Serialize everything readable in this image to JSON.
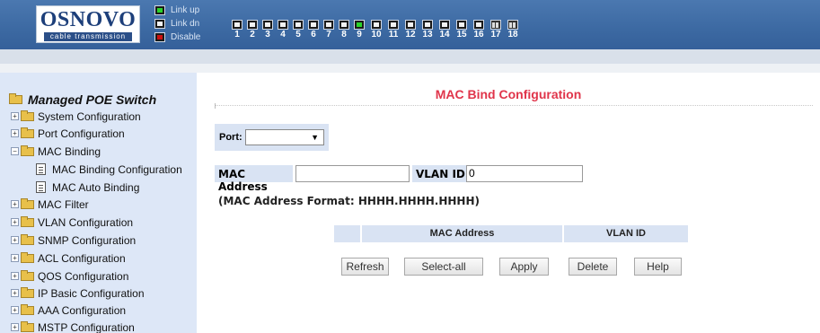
{
  "header": {
    "logo_main": "OSNOVO",
    "logo_sub": "cable transmission",
    "legend": [
      {
        "state": "up",
        "label": "Link up"
      },
      {
        "state": "dn",
        "label": "Link dn"
      },
      {
        "state": "down",
        "label": "Disable"
      }
    ],
    "ports": [
      {
        "num": "1",
        "state": "dn"
      },
      {
        "num": "2",
        "state": "dn"
      },
      {
        "num": "3",
        "state": "dn"
      },
      {
        "num": "4",
        "state": "dn"
      },
      {
        "num": "5",
        "state": "dn"
      },
      {
        "num": "6",
        "state": "dn"
      },
      {
        "num": "7",
        "state": "dn"
      },
      {
        "num": "8",
        "state": "dn"
      },
      {
        "num": "9",
        "state": "up"
      },
      {
        "num": "10",
        "state": "dn"
      },
      {
        "num": "11",
        "state": "dn"
      },
      {
        "num": "12",
        "state": "dn"
      },
      {
        "num": "13",
        "state": "dn"
      },
      {
        "num": "14",
        "state": "dn"
      },
      {
        "num": "15",
        "state": "dn"
      },
      {
        "num": "16",
        "state": "dn"
      },
      {
        "num": "17",
        "state": "fiber"
      },
      {
        "num": "18",
        "state": "fiber"
      }
    ]
  },
  "sidebar": {
    "title": "Managed POE Switch",
    "items": [
      {
        "label": "System Configuration",
        "type": "folder",
        "expander": "+"
      },
      {
        "label": "Port Configuration",
        "type": "folder",
        "expander": "+"
      },
      {
        "label": "MAC Binding",
        "type": "folder-open",
        "expander": "−"
      },
      {
        "label": "MAC Binding Configuration",
        "type": "leaf"
      },
      {
        "label": "MAC Auto Binding",
        "type": "leaf"
      },
      {
        "label": "MAC Filter",
        "type": "folder",
        "expander": "+"
      },
      {
        "label": "VLAN Configuration",
        "type": "folder",
        "expander": "+"
      },
      {
        "label": "SNMP Configuration",
        "type": "folder",
        "expander": "+"
      },
      {
        "label": "ACL Configuration",
        "type": "folder",
        "expander": "+"
      },
      {
        "label": "QOS Configuration",
        "type": "folder",
        "expander": "+"
      },
      {
        "label": "IP Basic Configuration",
        "type": "folder",
        "expander": "+"
      },
      {
        "label": "AAA Configuration",
        "type": "folder",
        "expander": "+"
      },
      {
        "label": "MSTP Configuration",
        "type": "folder",
        "expander": "+"
      }
    ]
  },
  "main": {
    "title": "MAC Bind Configuration",
    "port_label": "Port:",
    "port_value": "",
    "mac_label": "MAC Address",
    "mac_value": "",
    "vlan_label": "VLAN ID",
    "vlan_value": "0",
    "format_note": "(MAC Address Format: HHHH.HHHH.HHHH)",
    "table_headers": [
      "",
      "MAC Address",
      "VLAN ID"
    ],
    "buttons": {
      "refresh": "Refresh",
      "select_all": "Select-all",
      "apply": "Apply",
      "delete": "Delete",
      "help": "Help"
    }
  },
  "colors": {
    "header_blue": "#3c69a2",
    "title_red": "#e0344a",
    "sidebar_bg": "#dde7f7",
    "label_cell_bg": "#d9e3f3",
    "link_up": "#2ad32a",
    "disable": "#cc1010"
  }
}
